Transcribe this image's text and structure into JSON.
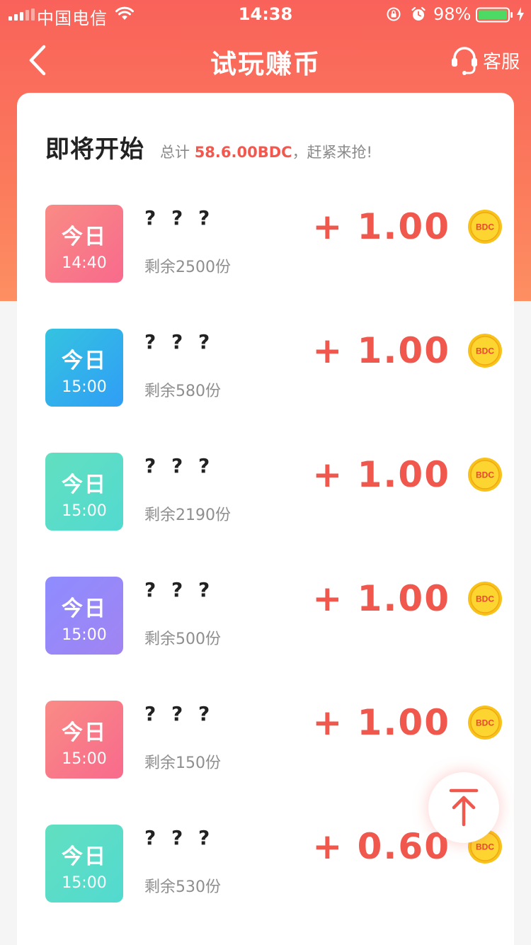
{
  "status_bar": {
    "carrier": "中国电信",
    "time": "14:38",
    "battery": "98%"
  },
  "nav": {
    "title": "试玩赚币",
    "service_label": "客服"
  },
  "section": {
    "title": "即将开始",
    "note_prefix": "总计 ",
    "note_amount": "58.6.00BDC",
    "note_suffix": "，赶紧来抢!"
  },
  "coin_label": "BDC",
  "tasks": [
    {
      "day": "今日",
      "time": "14:40",
      "name": "? ? ?",
      "remain": "剩余2500份",
      "reward": "+ 1.00",
      "color": "red"
    },
    {
      "day": "今日",
      "time": "15:00",
      "name": "? ? ?",
      "remain": "剩余580份",
      "reward": "+ 1.00",
      "color": "blue"
    },
    {
      "day": "今日",
      "time": "15:00",
      "name": "? ? ?",
      "remain": "剩余2190份",
      "reward": "+ 1.00",
      "color": "teal"
    },
    {
      "day": "今日",
      "time": "15:00",
      "name": "? ? ?",
      "remain": "剩余500份",
      "reward": "+ 1.00",
      "color": "purple"
    },
    {
      "day": "今日",
      "time": "15:00",
      "name": "? ? ?",
      "remain": "剩余150份",
      "reward": "+ 1.00",
      "color": "red"
    },
    {
      "day": "今日",
      "time": "15:00",
      "name": "? ? ?",
      "remain": "剩余530份",
      "reward": "+ 0.60",
      "color": "teal"
    }
  ],
  "colors": {
    "accent": "#f0584e",
    "header_top": "#f9625a",
    "header_bottom": "#fd8f62"
  }
}
